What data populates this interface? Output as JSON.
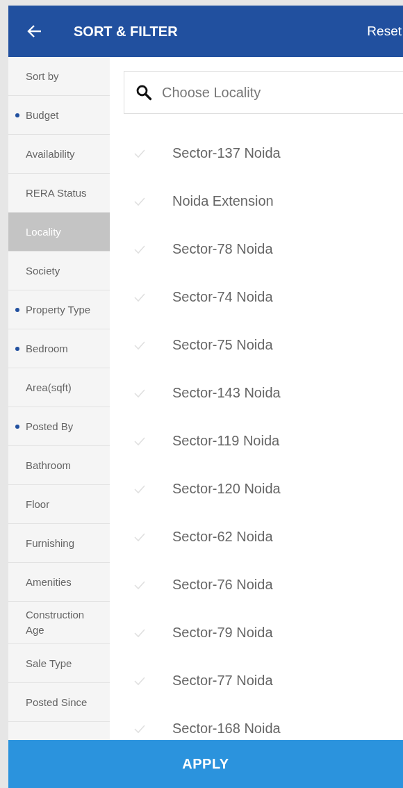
{
  "header": {
    "title": "SORT & FILTER",
    "reset": "Reset"
  },
  "sidebar": {
    "items": [
      {
        "label": "Sort by",
        "selected": false,
        "applied": false
      },
      {
        "label": "Budget",
        "selected": false,
        "applied": true
      },
      {
        "label": "Availability",
        "selected": false,
        "applied": false
      },
      {
        "label": "RERA Status",
        "selected": false,
        "applied": false
      },
      {
        "label": "Locality",
        "selected": true,
        "applied": false
      },
      {
        "label": "Society",
        "selected": false,
        "applied": false
      },
      {
        "label": "Property Type",
        "selected": false,
        "applied": true
      },
      {
        "label": "Bedroom",
        "selected": false,
        "applied": true
      },
      {
        "label": "Area(sqft)",
        "selected": false,
        "applied": false
      },
      {
        "label": "Posted By",
        "selected": false,
        "applied": true
      },
      {
        "label": "Bathroom",
        "selected": false,
        "applied": false
      },
      {
        "label": "Floor",
        "selected": false,
        "applied": false
      },
      {
        "label": "Furnishing",
        "selected": false,
        "applied": false
      },
      {
        "label": "Amenities",
        "selected": false,
        "applied": false
      },
      {
        "label": "Construction Age",
        "selected": false,
        "applied": false
      },
      {
        "label": "Sale Type",
        "selected": false,
        "applied": false
      },
      {
        "label": "Posted Since",
        "selected": false,
        "applied": false
      }
    ]
  },
  "search": {
    "placeholder": "Choose Locality"
  },
  "localities": [
    {
      "name": "Sector-137 Noida",
      "checked": false
    },
    {
      "name": "Noida Extension",
      "checked": false
    },
    {
      "name": "Sector-78 Noida",
      "checked": false
    },
    {
      "name": "Sector-74 Noida",
      "checked": false
    },
    {
      "name": "Sector-75 Noida",
      "checked": false
    },
    {
      "name": "Sector-143 Noida",
      "checked": false
    },
    {
      "name": "Sector-119 Noida",
      "checked": false
    },
    {
      "name": "Sector-120 Noida",
      "checked": false
    },
    {
      "name": "Sector-62 Noida",
      "checked": false
    },
    {
      "name": "Sector-76 Noida",
      "checked": false
    },
    {
      "name": "Sector-79 Noida",
      "checked": false
    },
    {
      "name": "Sector-77 Noida",
      "checked": false
    },
    {
      "name": "Sector-168 Noida",
      "checked": false
    }
  ],
  "apply": "APPLY"
}
